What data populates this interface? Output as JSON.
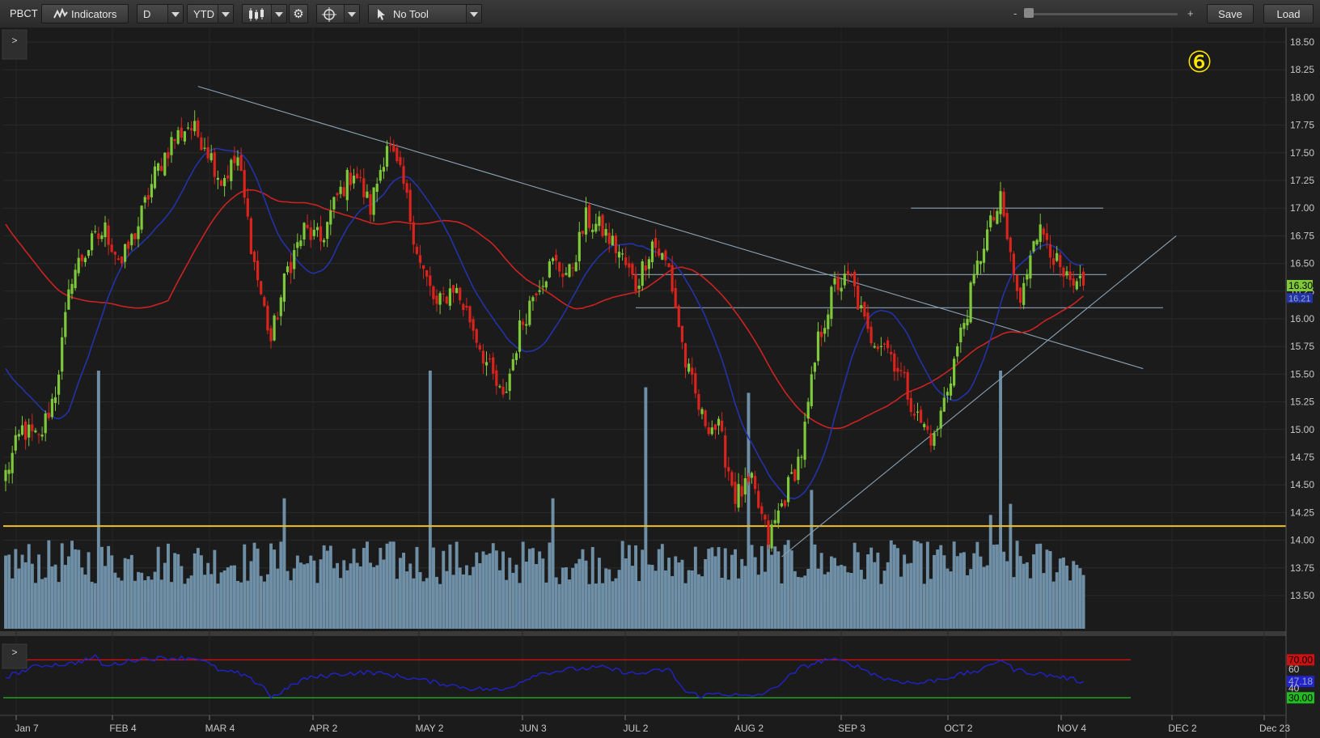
{
  "toolbar": {
    "symbol": "PBCT",
    "indicators_label": "Indicators",
    "aggregation": "D",
    "range": "YTD",
    "drawing_tool": "No Tool",
    "zoom_minus": "-",
    "zoom_plus": "+",
    "save_label": "Save",
    "load_label": "Load"
  },
  "annotation": {
    "marker": "⑥",
    "color": "#ffe600"
  },
  "collapse_price": ">",
  "collapse_rsi": ">",
  "colors": {
    "up": "#7ec83a",
    "down": "#d9231c",
    "volume": "#6e8fa6",
    "sma_slow": "#cc2222",
    "sma_fast": "#2233aa",
    "trendline": "#8aa2b4",
    "volume_avg": "#f0c020",
    "rsi": "#2222cc",
    "rsi_high": "#cc1111",
    "rsi_low": "#22bb22"
  },
  "chart_data": {
    "type": "candlestick",
    "symbol": "PBCT",
    "aggregation": "Daily",
    "price_axis": {
      "ticks": [
        "18.50",
        "18.25",
        "18.00",
        "17.75",
        "17.50",
        "17.25",
        "17.00",
        "16.75",
        "16.50",
        "16.25",
        "16.00",
        "15.75",
        "15.50",
        "15.25",
        "15.00",
        "14.75",
        "14.50",
        "14.25",
        "14.00",
        "13.75",
        "13.50"
      ],
      "ylim": [
        13.35,
        18.6
      ],
      "last_price_label": "16.30",
      "fast_ma_label": "16.21"
    },
    "x_axis": {
      "labels": [
        "Jan 7",
        "FEB 4",
        "MAR 4",
        "APR 2",
        "MAY 2",
        "JUN 3",
        "JUL 2",
        "AUG 2",
        "SEP 3",
        "OCT 2",
        "NOV 4",
        "DEC 2",
        "Dec 23"
      ]
    },
    "anchor_closes": [
      [
        0,
        14.6
      ],
      [
        5,
        15.0
      ],
      [
        10,
        14.9
      ],
      [
        15,
        15.35
      ],
      [
        20,
        16.4
      ],
      [
        25,
        16.65
      ],
      [
        30,
        16.8
      ],
      [
        35,
        16.5
      ],
      [
        40,
        16.85
      ],
      [
        45,
        17.3
      ],
      [
        50,
        17.6
      ],
      [
        55,
        17.75
      ],
      [
        60,
        17.6
      ],
      [
        65,
        17.25
      ],
      [
        70,
        17.45
      ],
      [
        75,
        16.5
      ],
      [
        80,
        15.8
      ],
      [
        85,
        16.45
      ],
      [
        90,
        16.8
      ],
      [
        95,
        16.7
      ],
      [
        100,
        17.1
      ],
      [
        105,
        17.35
      ],
      [
        110,
        17.0
      ],
      [
        115,
        17.6
      ],
      [
        120,
        17.2
      ],
      [
        125,
        16.5
      ],
      [
        130,
        16.1
      ],
      [
        135,
        16.3
      ],
      [
        140,
        16.0
      ],
      [
        145,
        15.6
      ],
      [
        150,
        15.25
      ],
      [
        155,
        15.9
      ],
      [
        160,
        16.3
      ],
      [
        165,
        16.5
      ],
      [
        170,
        16.4
      ],
      [
        175,
        16.9
      ],
      [
        180,
        16.8
      ],
      [
        185,
        16.6
      ],
      [
        190,
        16.3
      ],
      [
        195,
        16.7
      ],
      [
        200,
        16.45
      ],
      [
        205,
        15.6
      ],
      [
        210,
        15.1
      ],
      [
        215,
        15.0
      ],
      [
        220,
        14.4
      ],
      [
        225,
        14.5
      ],
      [
        230,
        14.0
      ],
      [
        235,
        14.4
      ],
      [
        240,
        14.8
      ],
      [
        245,
        15.8
      ],
      [
        250,
        16.3
      ],
      [
        255,
        16.35
      ],
      [
        260,
        15.85
      ],
      [
        265,
        15.8
      ],
      [
        270,
        15.5
      ],
      [
        275,
        15.1
      ],
      [
        280,
        14.9
      ],
      [
        285,
        15.5
      ],
      [
        290,
        16.1
      ],
      [
        295,
        16.7
      ],
      [
        300,
        17.05
      ],
      [
        304,
        16.4
      ],
      [
        306,
        16.1
      ],
      [
        310,
        16.8
      ],
      [
        314,
        16.75
      ],
      [
        318,
        16.4
      ],
      [
        322,
        16.25
      ],
      [
        325,
        16.3
      ]
    ],
    "volume_avg_level": 0.37,
    "volume_spikes": [
      [
        28,
        0.93
      ],
      [
        84,
        0.47
      ],
      [
        128,
        0.93
      ],
      [
        165,
        0.47
      ],
      [
        193,
        0.87
      ],
      [
        224,
        0.85
      ],
      [
        243,
        0.5
      ],
      [
        297,
        0.41
      ],
      [
        300,
        0.93
      ],
      [
        303,
        0.45
      ]
    ],
    "trendlines": [
      {
        "name": "descending",
        "from": [
          58,
          18.1
        ],
        "to": [
          343,
          15.55
        ]
      },
      {
        "name": "ascending",
        "from": [
          234,
          13.85
        ],
        "to": [
          353,
          16.75
        ]
      },
      {
        "name": "resistance-17",
        "from": [
          273,
          17.0
        ],
        "to": [
          331,
          17.0
        ]
      },
      {
        "name": "level-16.40",
        "from": [
          189,
          16.4
        ],
        "to": [
          332,
          16.4
        ]
      },
      {
        "name": "level-16.10",
        "from": [
          190,
          16.1
        ],
        "to": [
          349,
          16.1
        ]
      }
    ],
    "rsi": {
      "labels": [
        "70.00",
        "60",
        "47.18",
        "40",
        "30.00"
      ],
      "overbought": 70,
      "oversold": 30,
      "current": 47.18,
      "anchors": [
        [
          0,
          52
        ],
        [
          10,
          64
        ],
        [
          20,
          66
        ],
        [
          27,
          73
        ],
        [
          30,
          63
        ],
        [
          40,
          71
        ],
        [
          50,
          72
        ],
        [
          58,
          72
        ],
        [
          65,
          58
        ],
        [
          70,
          56
        ],
        [
          78,
          42
        ],
        [
          80,
          30
        ],
        [
          90,
          50
        ],
        [
          100,
          55
        ],
        [
          110,
          57
        ],
        [
          120,
          52
        ],
        [
          130,
          46
        ],
        [
          140,
          40
        ],
        [
          150,
          38
        ],
        [
          160,
          55
        ],
        [
          170,
          60
        ],
        [
          180,
          62
        ],
        [
          190,
          55
        ],
        [
          200,
          60
        ],
        [
          205,
          36
        ],
        [
          210,
          32
        ],
        [
          215,
          35
        ],
        [
          224,
          31
        ],
        [
          230,
          36
        ],
        [
          240,
          62
        ],
        [
          248,
          71
        ],
        [
          255,
          66
        ],
        [
          265,
          50
        ],
        [
          275,
          45
        ],
        [
          285,
          52
        ],
        [
          295,
          60
        ],
        [
          300,
          71
        ],
        [
          304,
          60
        ],
        [
          310,
          56
        ],
        [
          318,
          52
        ],
        [
          325,
          47
        ]
      ]
    }
  }
}
